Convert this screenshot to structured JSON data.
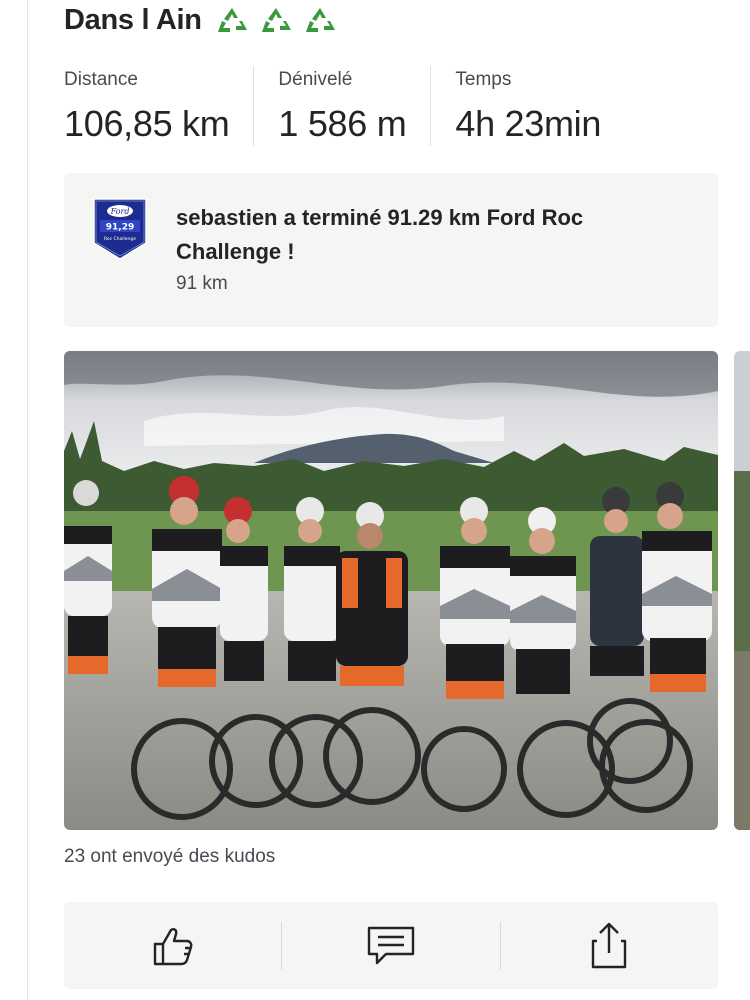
{
  "activity": {
    "title": "Dans l Ain",
    "title_emojis": [
      "recycle-icon",
      "recycle-icon",
      "recycle-icon"
    ]
  },
  "stats": [
    {
      "label": "Distance",
      "value": "106,85 km"
    },
    {
      "label": "Dénivelé",
      "value": "1 586 m"
    },
    {
      "label": "Temps",
      "value": "4h 23min"
    }
  ],
  "challenge": {
    "text": "sebastien a terminé 91.29 km Ford Roc Challenge !",
    "subtitle": "91 km",
    "badge": {
      "brand": "Ford",
      "distance": "91,29",
      "name": "Roc Challenge",
      "color": "#1d2c8e"
    }
  },
  "photo": {
    "description_icon": "group-cyclists-photo"
  },
  "kudos_text": "23 ont envoyé des kudos",
  "actions": [
    {
      "name": "kudos",
      "icon": "thumbs-up-icon"
    },
    {
      "name": "comment",
      "icon": "comment-icon"
    },
    {
      "name": "share",
      "icon": "share-icon"
    }
  ],
  "colors": {
    "text": "#242428",
    "muted": "#4a4a52",
    "card_bg": "#f5f5f3",
    "recycle_green": "#3a9a3a"
  }
}
